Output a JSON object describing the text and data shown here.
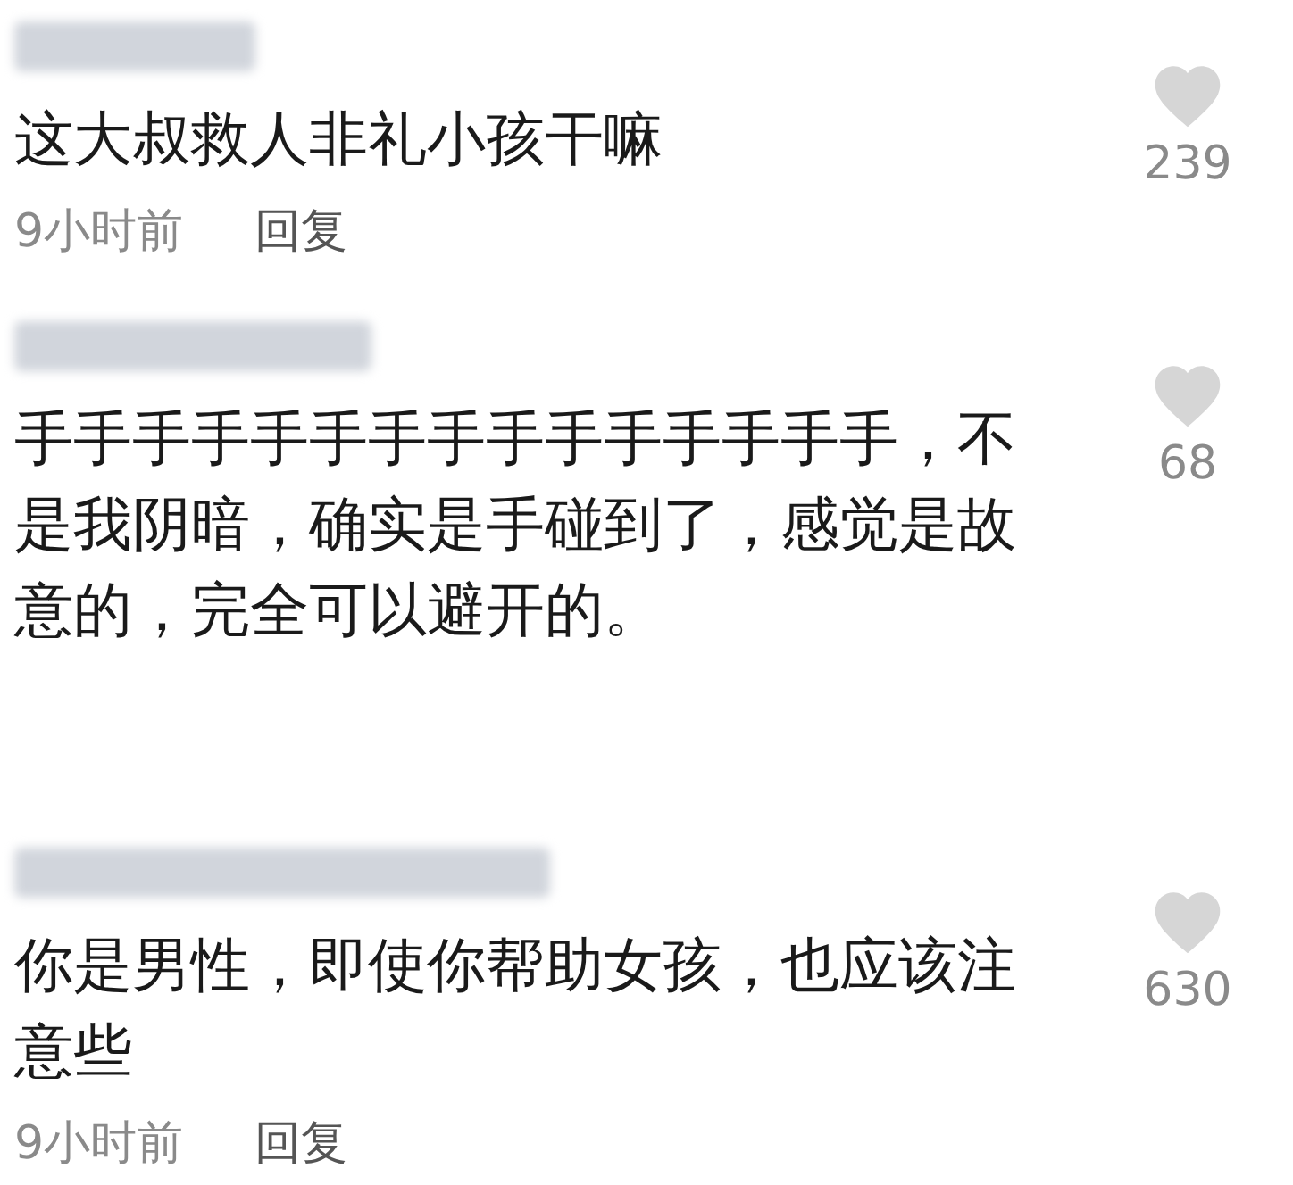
{
  "comments": [
    {
      "text": "这大叔救人非礼小孩干嘛",
      "likes": "239",
      "time": "9小时前",
      "reply": "回复"
    },
    {
      "text": "手手手手手手手手手手手手手手手，不是我阴暗，确实是手碰到了，感觉是故意的，完全可以避开的。",
      "likes": "68"
    },
    {
      "text": "你是男性，即使你帮助女孩，也应该注意些",
      "likes": "630",
      "time": "9小时前",
      "reply": "回复"
    }
  ]
}
